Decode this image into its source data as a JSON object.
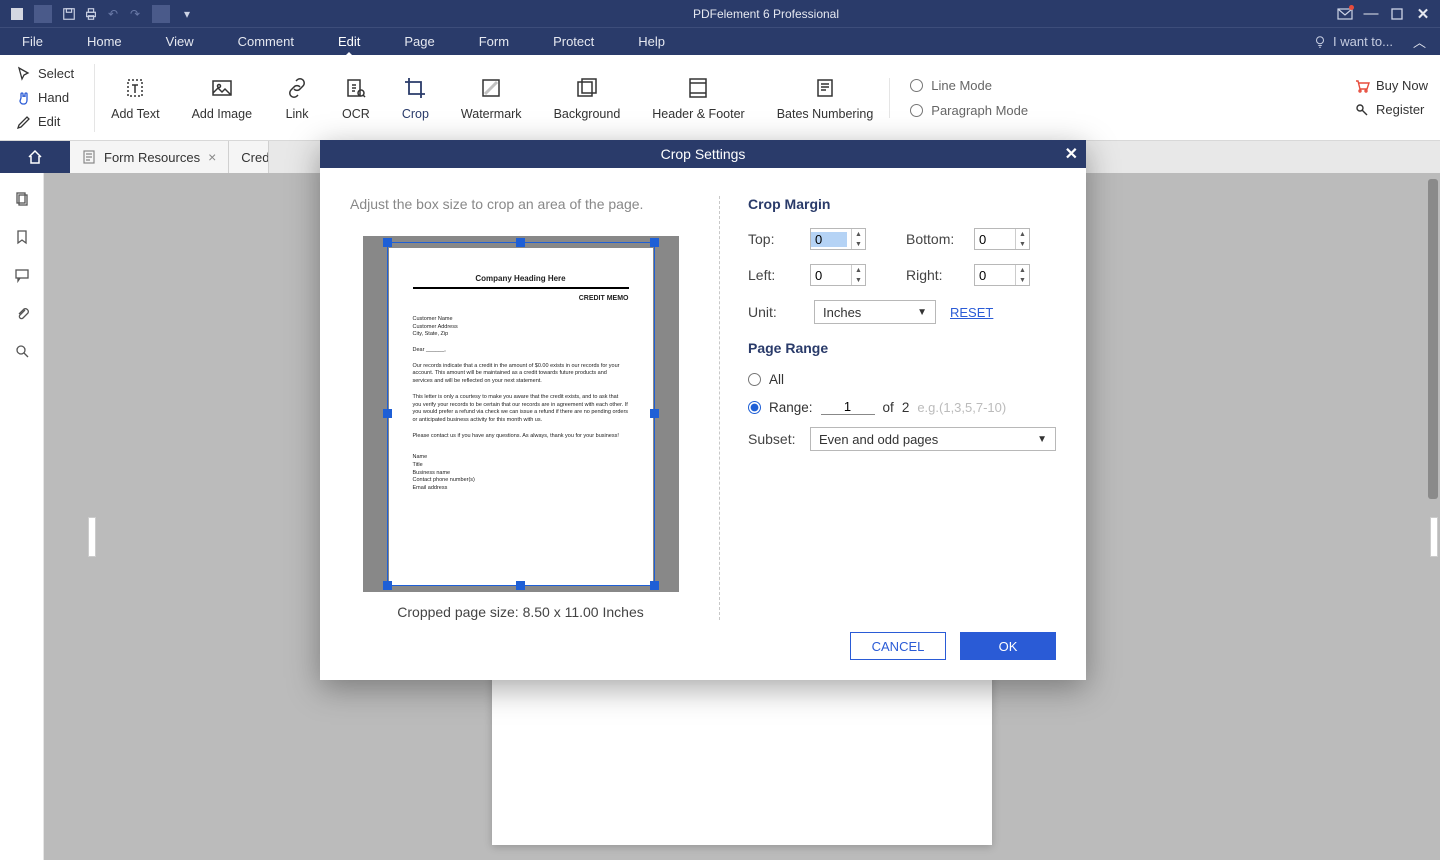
{
  "app": {
    "title": "PDFelement 6 Professional"
  },
  "menubar": {
    "items": [
      "File",
      "Home",
      "View",
      "Comment",
      "Edit",
      "Page",
      "Form",
      "Protect",
      "Help"
    ],
    "active": "Edit",
    "iwant": "I want to..."
  },
  "ribbon": {
    "left": {
      "select": "Select",
      "hand": "Hand",
      "edit": "Edit"
    },
    "tools": {
      "addtext": "Add Text",
      "addimage": "Add Image",
      "link": "Link",
      "ocr": "OCR",
      "crop": "Crop",
      "watermark": "Watermark",
      "background": "Background",
      "headerfooter": "Header & Footer",
      "bates": "Bates Numbering"
    },
    "modes": {
      "line": "Line Mode",
      "paragraph": "Paragraph Mode"
    },
    "right": {
      "buy": "Buy Now",
      "register": "Register"
    }
  },
  "tabs": {
    "form_resources": "Form Resources",
    "second": "Cred"
  },
  "dialog": {
    "title": "Crop Settings",
    "hint": "Adjust the box size to crop an area of the page.",
    "size_text": "Cropped page size: 8.50 x 11.00 Inches",
    "margin_header": "Crop Margin",
    "labels": {
      "top": "Top:",
      "bottom": "Bottom:",
      "left": "Left:",
      "right": "Right:",
      "unit": "Unit:",
      "subset": "Subset:"
    },
    "values": {
      "top": "0",
      "bottom": "0",
      "left": "0",
      "right": "0"
    },
    "unit": "Inches",
    "reset": "RESET",
    "range_header": "Page Range",
    "all_label": "All",
    "range_label": "Range:",
    "range_value": "1",
    "of_label": "of",
    "total_pages": "2",
    "example": "e.g.(1,3,5,7-10)",
    "subset_value": "Even and odd pages",
    "cancel": "CANCEL",
    "ok": "OK",
    "doc": {
      "heading": "Company Heading Here",
      "memo": "CREDIT MEMO",
      "addr": "Customer Name\nCustomer Address\nCity, State, Zip",
      "dear": "Dear ______,",
      "p1": "Our records indicate that a credit in the amount of $0.00 exists in our records for your account. This amount will be maintained as a credit towards future products and services and will be reflected on your next statement.",
      "p2": "This letter is only a courtesy to make you aware that the credit exists, and to ask that you verify your records to be certain that our records are in agreement with each other. If you would prefer a refund via check we can issue a refund if there are no pending orders or anticipated business activity for this month with us.",
      "p3": "Please contact us if you have any questions. As always, thank you for your business!",
      "sig": "Name\nTitle\nBusiness name\nContact phone number(s)\nEmail address"
    }
  }
}
